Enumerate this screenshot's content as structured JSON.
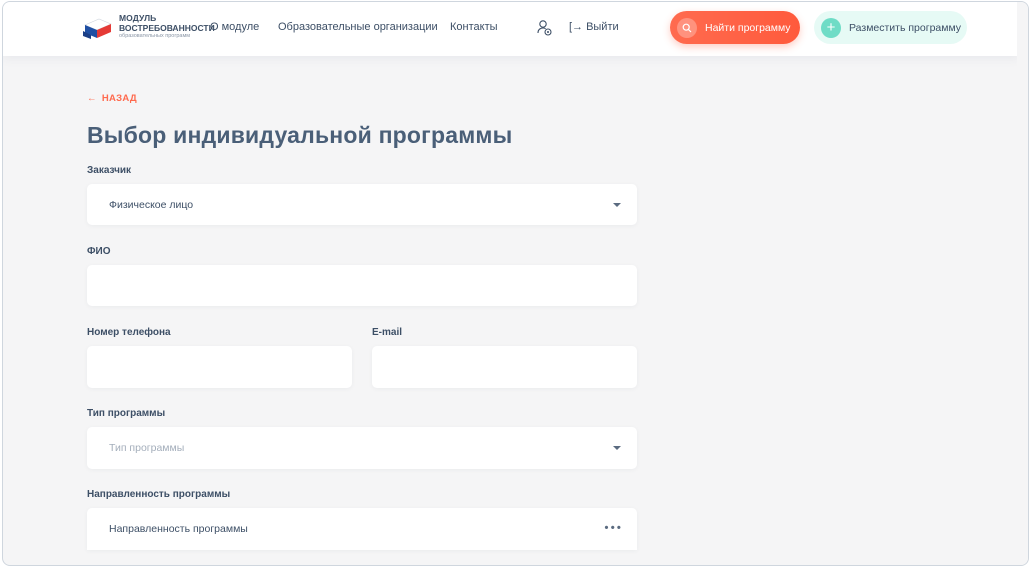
{
  "logo": {
    "title_line1": "МОДУЛЬ",
    "title_line2": "ВОСТРЕБОВАННОСТИ",
    "subtitle": "образовательных программ"
  },
  "nav": {
    "about": "О модуле",
    "organizations": "Образовательные организации",
    "contacts": "Контакты",
    "logout": "Выйти"
  },
  "buttons": {
    "find": "Найти программу",
    "place": "Разместить программу"
  },
  "page": {
    "back": "НАЗАД",
    "title": "Выбор индивидуальной программы"
  },
  "form": {
    "customer": {
      "label": "Заказчик",
      "value": "Физическое лицо"
    },
    "fio": {
      "label": "ФИО",
      "value": ""
    },
    "phone": {
      "label": "Номер телефона",
      "value": ""
    },
    "email": {
      "label": "E-mail",
      "value": ""
    },
    "program_type": {
      "label": "Тип программы",
      "placeholder": "Тип программы"
    },
    "program_direction": {
      "label": "Направленность программы",
      "placeholder": "Направленность программы"
    }
  },
  "colors": {
    "accent": "#ff6a4e",
    "secondary": "#6fdcc6",
    "text": "#3d4f66",
    "background": "#f5f5f6"
  }
}
